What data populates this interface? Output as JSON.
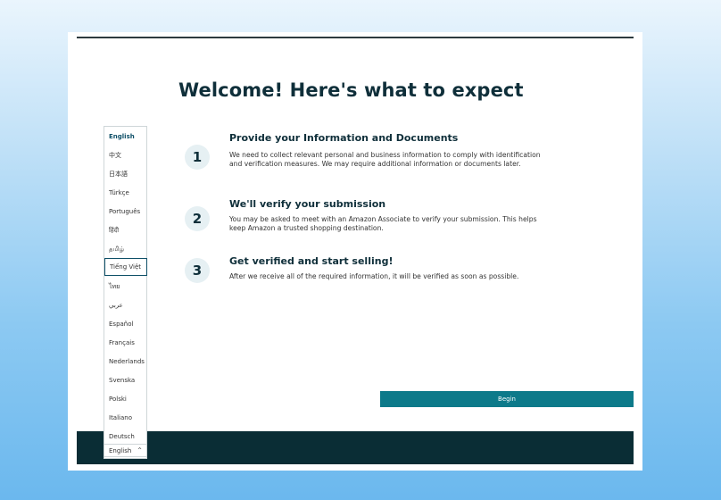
{
  "page": {
    "title": "Welcome! Here's what to expect"
  },
  "steps": [
    {
      "number": "1",
      "title": "Provide your Information and Documents",
      "description": "We need to collect relevant personal and business information to comply with identification and verification measures. We may require additional information or documents later."
    },
    {
      "number": "2",
      "title": "We'll verify your submission",
      "description": "You may be asked to meet with an Amazon Associate to verify your submission. This helps keep Amazon a trusted shopping destination."
    },
    {
      "number": "3",
      "title": "Get verified and start selling!",
      "description": "After we receive all of the required information, it will be verified as soon as possible."
    }
  ],
  "begin_button": {
    "label": "Begin"
  },
  "language_menu": {
    "selected": "English",
    "hovered": "Tiếng Việt",
    "items": [
      "English",
      "中文",
      "日本語",
      "Türkçe",
      "Português",
      "हिंदी",
      "தமிழ்",
      "Tiếng Việt",
      "ไทย",
      "عربي",
      "Español",
      "Français",
      "Nederlands",
      "Svenska",
      "Polski",
      "Italiano",
      "Deutsch"
    ]
  },
  "language_toggle": {
    "label": "English",
    "icon": "chevron-up-icon"
  },
  "colors": {
    "accent": "#0d7a8a",
    "footer": "#0a2d35",
    "heading": "#0f2f3a"
  }
}
